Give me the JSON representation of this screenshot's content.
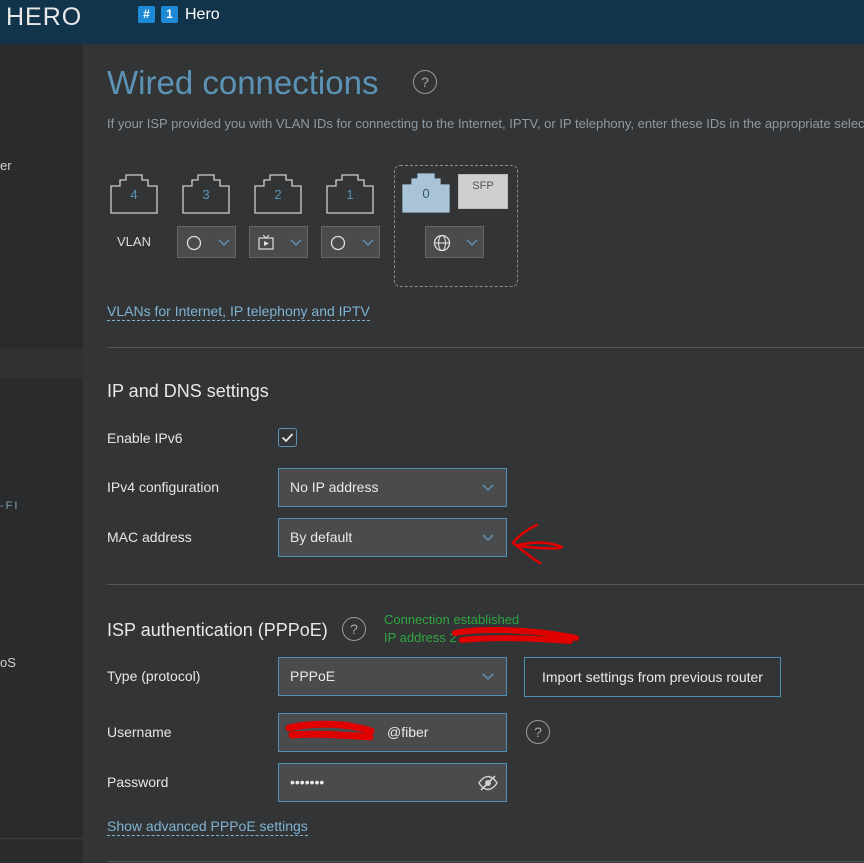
{
  "header": {
    "logo": "HERO",
    "hash_tag": "#",
    "device_num": "1",
    "device_name": "Hero"
  },
  "sidebar": {
    "items": [
      {
        "label": "er"
      },
      {
        "label": "-FI"
      },
      {
        "label": "oS"
      }
    ]
  },
  "page": {
    "title": "Wired connections",
    "help": "?",
    "intro": "If your ISP provided you with VLAN IDs for connecting to the Internet, IPTV, or IP telephony, enter these IDs in the appropriate selection."
  },
  "ports": {
    "lan": [
      {
        "number": "4"
      },
      {
        "number": "3"
      },
      {
        "number": "2"
      },
      {
        "number": "1"
      }
    ],
    "wan": {
      "number": "0"
    },
    "sfp": "SFP",
    "vlan_label": "VLAN",
    "selectors": [
      {
        "icon": "circle-icon"
      },
      {
        "icon": "tv-icon"
      },
      {
        "icon": "circle-icon"
      },
      {
        "icon": "globe-icon"
      }
    ]
  },
  "vlan_link": "VLANs for Internet, IP telephony and IPTV",
  "ip_dns": {
    "title": "IP and DNS settings",
    "ipv6_label": "Enable IPv6",
    "ipv6_checked": true,
    "ipv4_label": "IPv4 configuration",
    "ipv4_value": "No IP address",
    "mac_label": "MAC address",
    "mac_value": "By default"
  },
  "isp": {
    "title": "ISP authentication (PPPoE)",
    "help": "?",
    "status_line1": "Connection established",
    "status_line2": "IP address 2",
    "type_label": "Type (protocol)",
    "type_value": "PPPoE",
    "import_button": "Import settings from previous router",
    "username_label": "Username",
    "username_value": "@fiber",
    "username_help": "?",
    "password_label": "Password",
    "password_value": "•••••••",
    "advanced_link": "Show advanced PPPoE settings"
  },
  "colors": {
    "accent": "#5b93b5",
    "topbar": "#12344a",
    "status_green": "#2fa640",
    "annotation_red": "#e00000"
  }
}
